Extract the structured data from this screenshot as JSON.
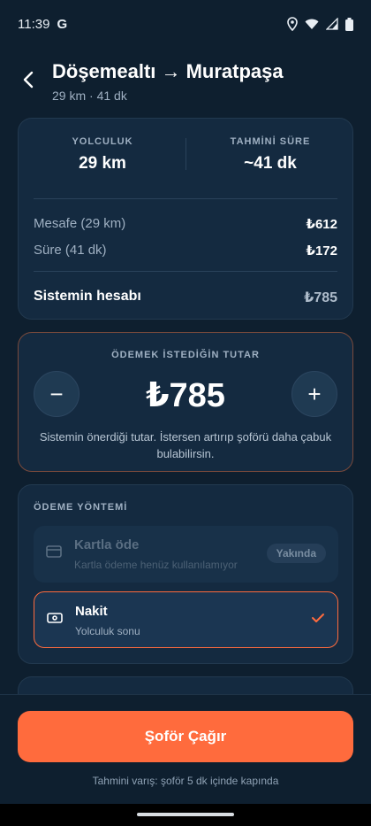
{
  "status_bar": {
    "time": "11:39",
    "app_glyph": "G"
  },
  "header": {
    "title": "Döşemealtı → Muratpaşa",
    "subtitle": "29 km · 41 dk"
  },
  "summary": {
    "trip_label": "YOLCULUK",
    "trip_value": "29 km",
    "duration_label": "TAHMİNİ SÜRE",
    "duration_value": "~41 dk",
    "rows": [
      {
        "label": "Mesafe (29 km)",
        "value": "₺612"
      },
      {
        "label": "Süre (41 dk)",
        "value": "₺172"
      }
    ],
    "total_label": "Sistemin hesabı",
    "total_value": "₺785"
  },
  "amount": {
    "label": "ÖDEMEK İSTEDİĞİN TUTAR",
    "value": "₺785",
    "minus": "−",
    "plus": "+",
    "help": "Sistemin önerdiği tutar. İstersen artırıp şoförü daha çabuk bulabilirsin."
  },
  "payment": {
    "label": "ÖDEME YÖNTEMİ",
    "card": {
      "title": "Kartla öde",
      "sub": "Kartla ödeme henüz kullanılamıyor",
      "badge": "Yakında"
    },
    "cash": {
      "title": "Nakit",
      "sub": "Yolculuk sonu",
      "selected": true
    }
  },
  "cta": {
    "label": "Şoför Çağır",
    "eta": "Tahmini varış: şoför 5 dk içinde kapında"
  },
  "colors": {
    "accent": "#ff6b3d",
    "background": "#0e1f2f",
    "card": "#142a40"
  }
}
